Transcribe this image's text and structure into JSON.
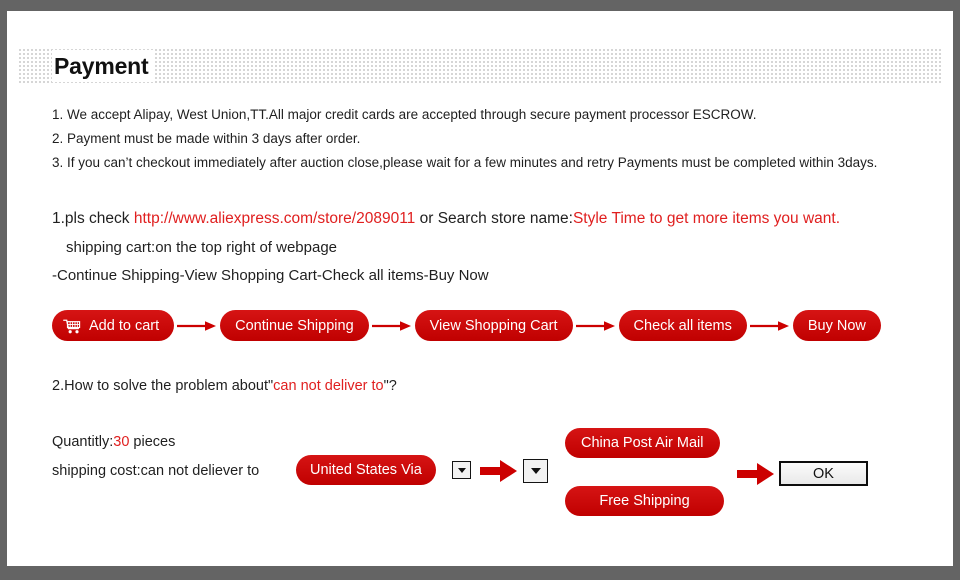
{
  "header": {
    "title": "Payment"
  },
  "terms": [
    "1. We accept Alipay, West Union,TT.All major credit cards are accepted through secure payment processor ESCROW.",
    "2. Payment must be made within 3 days after order.",
    "3. If you can’t checkout immediately after auction close,please wait for a few minutes and retry Payments must be completed within 3days."
  ],
  "store_instructions": {
    "line1_prefix": "1.pls check ",
    "line1_url": "http://www.aliexpress.com/store/2089011",
    "line1_middle": " or Search store name:",
    "line1_store": "Style Time to get more items you want.",
    "line2": "shipping cart:on the top right of webpage",
    "line3": "-Continue Shipping-View Shopping Cart-Check all items-Buy Now"
  },
  "flow": {
    "steps": [
      {
        "label": "Add to cart",
        "icon": "shopping-cart-icon"
      },
      {
        "label": "Continue Shipping",
        "icon": ""
      },
      {
        "label": "View Shopping Cart",
        "icon": ""
      },
      {
        "label": "Check all items",
        "icon": ""
      },
      {
        "label": "Buy Now",
        "icon": ""
      }
    ],
    "separator_icon": "arrow-right-icon"
  },
  "problem": {
    "prefix": "2.How to solve the problem about\"",
    "highlight": "can not deliver to",
    "suffix": "\"?"
  },
  "shipping_demo": {
    "quantity_label": "Quantitly:",
    "quantity_value": "30",
    "quantity_unit": " pieces",
    "cost_label": "shipping cost:can not deliever to ",
    "country_pill": "United States Via",
    "dropdown_small_icon": "chevron-down-icon",
    "dropdown_big_icon": "chevron-down-icon",
    "arrow_icon": "arrow-right-thick-icon",
    "option_1": "China Post Air Mail",
    "option_2": "Free Shipping",
    "confirm_label": "OK"
  },
  "colors": {
    "brand_red": "#cc0000",
    "link_red": "#e01f1f",
    "frame_gray": "#646464"
  }
}
